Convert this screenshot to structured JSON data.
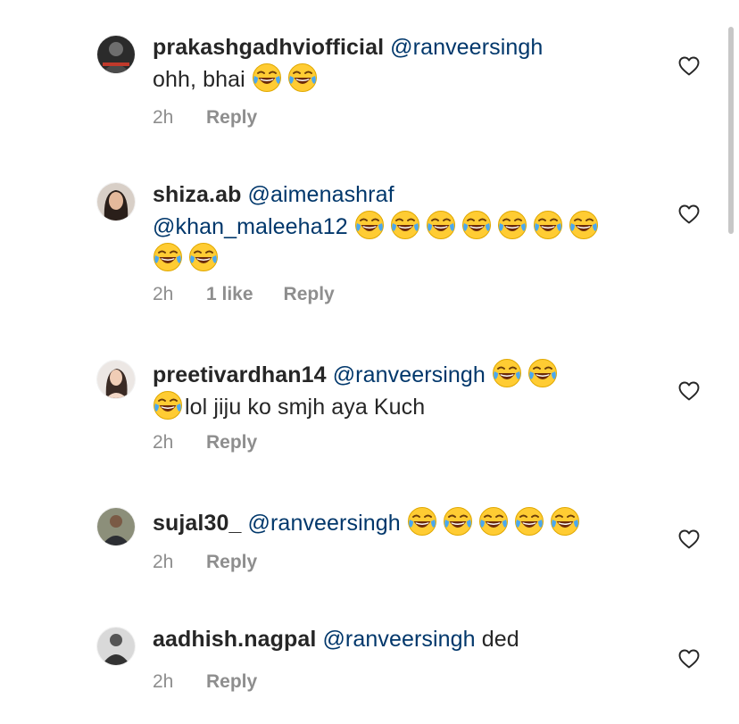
{
  "comments": [
    {
      "username": "prakashgadhviofficial",
      "mention": "@ranveersingh",
      "line2": "ohh,  bhai",
      "time": "2h",
      "reply": "Reply"
    },
    {
      "username": "shiza.ab",
      "mention": "@aimenashraf",
      "mention2": "@khan_maleeha12",
      "time": "2h",
      "likes": "1 like",
      "reply": "Reply"
    },
    {
      "username": "preetivardhan14",
      "mention": "@ranveersingh",
      "line2": "lol jiju ko smjh aya  Kuch",
      "time": "2h",
      "reply": "Reply"
    },
    {
      "username": "sujal30_",
      "mention": "@ranveersingh",
      "time": "2h",
      "reply": "Reply"
    },
    {
      "username": "aadhish.nagpal",
      "mention": "@ranveersingh",
      "trailing": " ded",
      "time": "2h",
      "reply": "Reply"
    }
  ],
  "icons": {
    "emoji": "face-with-tears-of-joy-icon",
    "like": "heart-outline-icon"
  },
  "colors": {
    "text": "#262626",
    "mention": "#00376b",
    "secondary": "#8e8e8e"
  }
}
